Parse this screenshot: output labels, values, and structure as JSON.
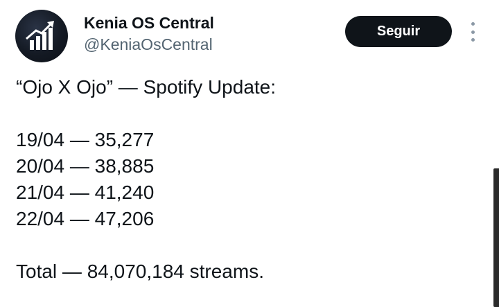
{
  "author": {
    "name": "Kenia OS Central",
    "handle": "@KeniaOsCentral",
    "avatar_icon": "rising-chart-icon"
  },
  "actions": {
    "follow_label": "Seguir",
    "more_icon": "more-vertical-icon"
  },
  "tweet": {
    "headline": "“Ojo X Ojo” — Spotify Update:",
    "daily": [
      "19/04 — 35,277",
      "20/04 — 38,885",
      "21/04 — 41,240",
      "22/04 — 47,206"
    ],
    "total": "Total — 84,070,184 streams."
  },
  "colors": {
    "text_primary": "#0f1419",
    "text_secondary": "#536471",
    "button_bg": "#0f1419",
    "button_text": "#ffffff"
  }
}
